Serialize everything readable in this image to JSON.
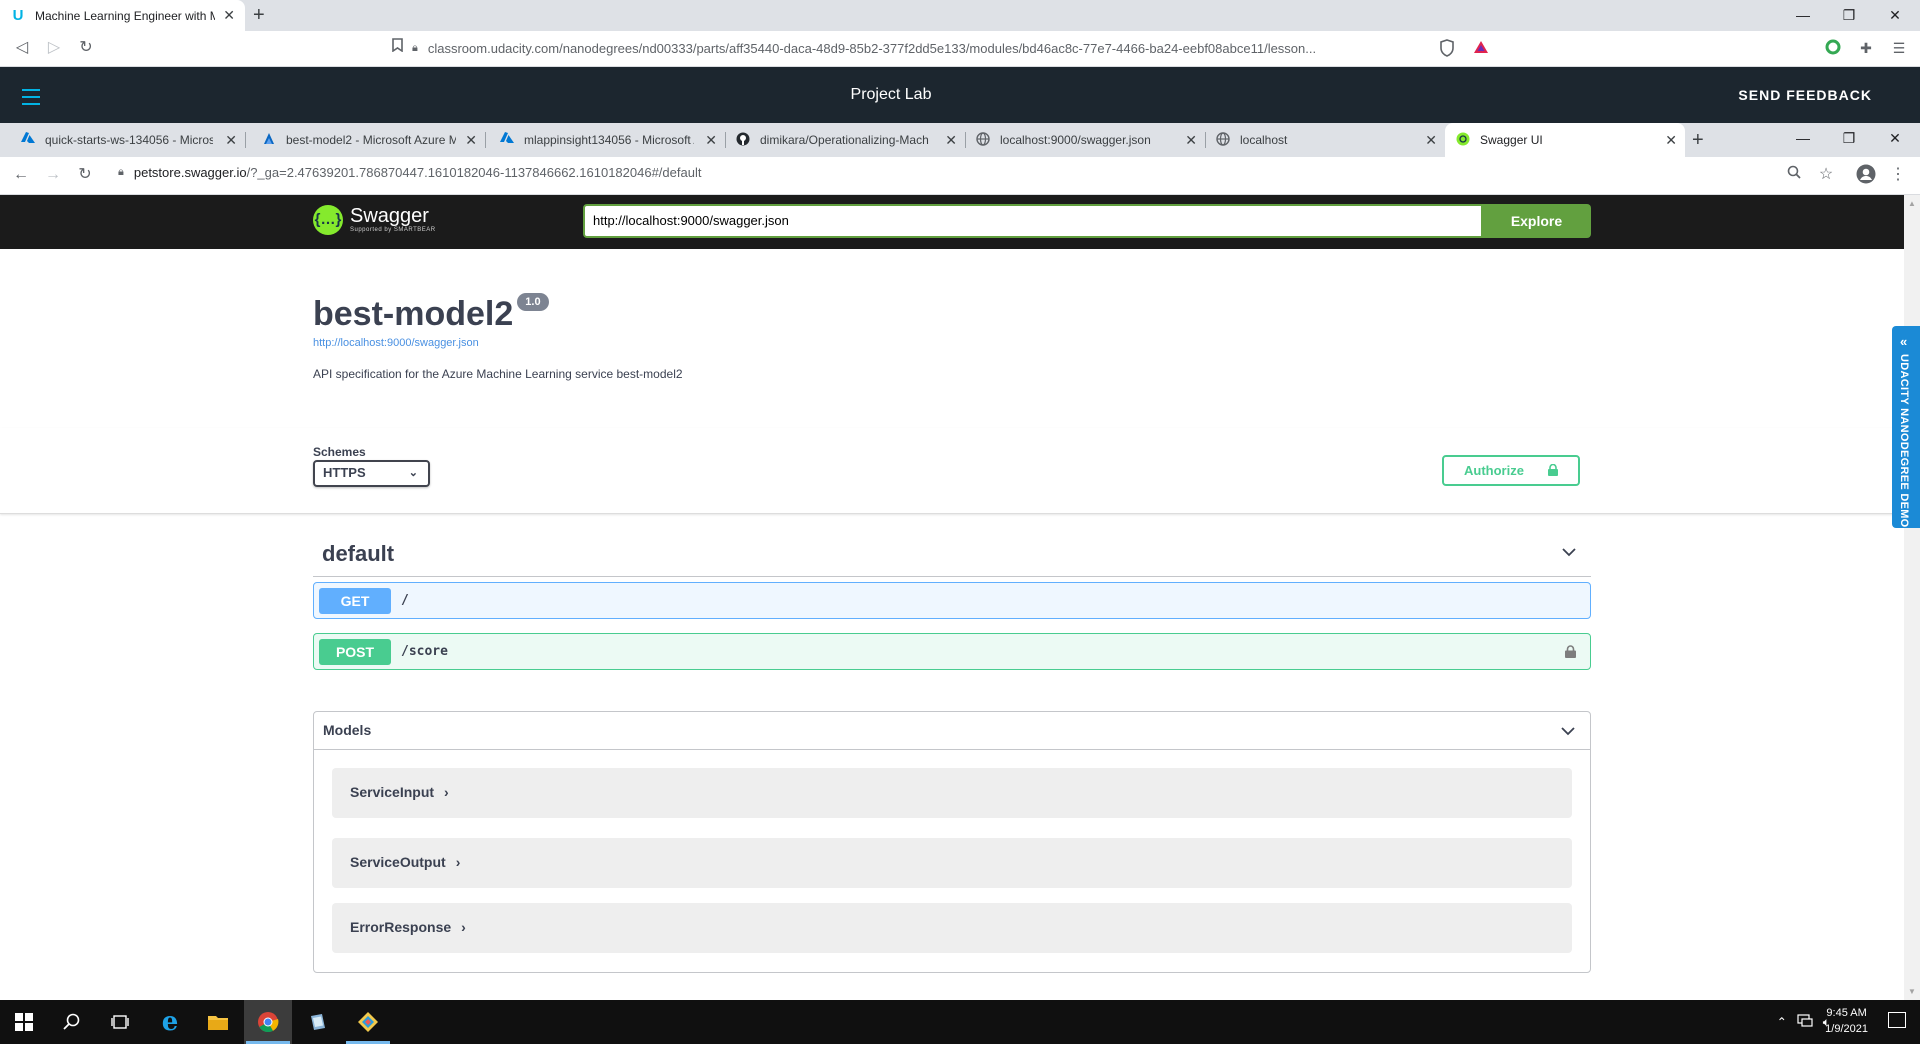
{
  "outer_browser": {
    "tab_title": "Machine Learning Engineer with M",
    "url": "classroom.udacity.com/nanodegrees/nd00333/parts/aff35440-daca-48d9-85b2-377f2dd5e133/modules/bd46ac8c-77e7-4466-ba24-eebf08abce11/lesson..."
  },
  "udacity_bar": {
    "title": "Project Lab",
    "feedback": "SEND FEEDBACK",
    "side_tab": "UDACITY NANODEGREE DEMO"
  },
  "inner_browser": {
    "tabs": [
      {
        "title": "quick-starts-ws-134056 - Microso",
        "icon": "azure-icon"
      },
      {
        "title": "best-model2 - Microsoft Azure M",
        "icon": "azure-ml-icon"
      },
      {
        "title": "mlappinsight134056 - Microsoft A",
        "icon": "azure-icon"
      },
      {
        "title": "dimikara/Operationalizing-Mach",
        "icon": "github-icon"
      },
      {
        "title": "localhost:9000/swagger.json",
        "icon": "globe-icon"
      },
      {
        "title": "localhost",
        "icon": "globe-icon"
      },
      {
        "title": "Swagger UI",
        "icon": "swagger-icon"
      }
    ],
    "url_host": "petstore.swagger.io",
    "url_rest": "/?_ga=2.47639201.786870447.1610182046-1137846662.1610182046#/default"
  },
  "swagger": {
    "logo_name": "Swagger",
    "logo_by": "Supported by SMARTBEAR",
    "spec_url": "http://localhost:9000/swagger.json",
    "explore_label": "Explore",
    "title": "best-model2",
    "version": "1.0",
    "spec_link": "http://localhost:9000/swagger.json",
    "description": "API specification for the Azure Machine Learning service best-model2",
    "schemes_label": "Schemes",
    "scheme_selected": "HTTPS",
    "authorize_label": "Authorize",
    "tag_name": "default",
    "operations": [
      {
        "method": "GET",
        "path": "/"
      },
      {
        "method": "POST",
        "path": "/score"
      }
    ],
    "models_label": "Models",
    "models": [
      "ServiceInput",
      "ServiceOutput",
      "ErrorResponse"
    ]
  },
  "taskbar": {
    "time": "9:45 AM",
    "date": "1/9/2021"
  },
  "colors": {
    "get": "#61affe",
    "post": "#49cc90",
    "swagger_green": "#62a03f",
    "udacity_dark": "#1c262f",
    "udacity_blue": "#02b3e4"
  }
}
